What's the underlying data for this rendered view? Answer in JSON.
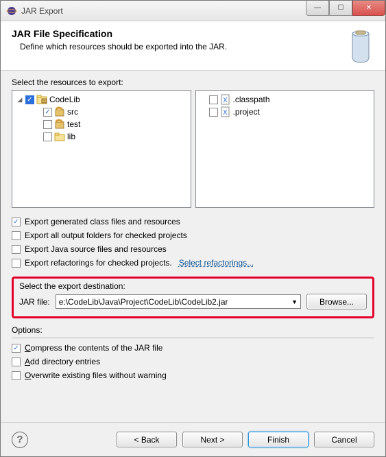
{
  "window": {
    "title": "JAR Export"
  },
  "header": {
    "title": "JAR File Specification",
    "subtitle": "Define which resources should be exported into the JAR."
  },
  "resources": {
    "label": "Select the resources to export:",
    "left": [
      {
        "label": "CodeLib",
        "indent": 0,
        "checked": "filled",
        "icon": "project",
        "expandable": true
      },
      {
        "label": "src",
        "indent": 1,
        "checked": "checked",
        "icon": "package"
      },
      {
        "label": "test",
        "indent": 1,
        "checked": "",
        "icon": "package"
      },
      {
        "label": "lib",
        "indent": 1,
        "checked": "",
        "icon": "folder"
      }
    ],
    "right": [
      {
        "label": ".classpath",
        "checked": "",
        "icon": "x-file"
      },
      {
        "label": ".project",
        "checked": "",
        "icon": "x-file"
      }
    ]
  },
  "exportOptions": [
    {
      "label": "Export generated class files and resources",
      "checked": true
    },
    {
      "label": "Export all output folders for checked projects",
      "checked": false
    },
    {
      "label": "Export Java source files and resources",
      "checked": false
    },
    {
      "label": "Export refactorings for checked projects.",
      "checked": false,
      "link": "Select refactorings..."
    }
  ],
  "destination": {
    "groupLabel": "Select the export destination:",
    "fieldLabel": "JAR file:",
    "path": "e:\\CodeLib\\Java\\Project\\CodeLib\\CodeLib2.jar",
    "browseLabel": "Browse..."
  },
  "options": {
    "label": "Options:",
    "items": [
      {
        "prefix": "C",
        "rest": "ompress the contents of the JAR file",
        "checked": true
      },
      {
        "prefix": "A",
        "rest": "dd directory entries",
        "checked": false
      },
      {
        "prefix": "O",
        "rest": "verwrite existing files without warning",
        "checked": false
      }
    ]
  },
  "footer": {
    "back": "< Back",
    "next": "Next >",
    "finish": "Finish",
    "cancel": "Cancel"
  }
}
